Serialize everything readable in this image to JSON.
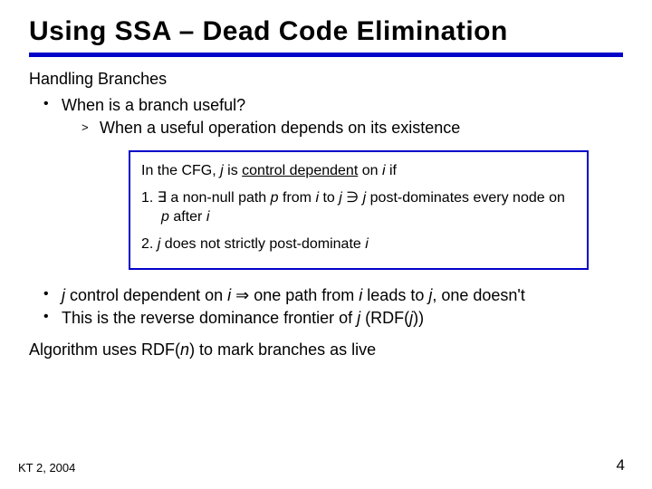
{
  "title": "Using SSA – Dead Code Elimination",
  "subhead": "Handling Branches",
  "bullet1": {
    "main": "When is a branch useful?",
    "sub": "When a useful operation depends on its existence"
  },
  "box": {
    "intro_a": "In the CFG, ",
    "j1": "j",
    "intro_b": " is ",
    "cd": "control dependent",
    "intro_c": " on ",
    "i1": "i",
    "intro_d": "  if",
    "l1_a": "1. ∃ a non-null path ",
    "p": "p",
    "l1_b": " from ",
    "i2": "i",
    "l1_c": " to ",
    "j2": "j",
    "l1_d": " ∋ ",
    "j3": "j",
    "l1_e": " post-dominates every node on ",
    "p2": "p",
    "l1_f": " after ",
    "i3": "i",
    "l2_a": "2. ",
    "j4": "j",
    "l2_b": " does not strictly post-dominate ",
    "i4": "i"
  },
  "bullet2_a": "j",
  "bullet2_b": " control dependent on ",
  "bullet2_c": "i",
  "bullet2_d": " ⇒ one path from ",
  "bullet2_e": "i",
  "bullet2_f": " leads to ",
  "bullet2_g": "j",
  "bullet2_h": ", one doesn't",
  "bullet3_a": "This is the reverse dominance frontier of ",
  "bullet3_b": "j",
  "bullet3_c": "  (RDF(",
  "bullet3_d": "j",
  "bullet3_e": "))",
  "algo_a": "Algorithm uses RDF(",
  "algo_n": "n",
  "algo_b": ") to mark branches as live",
  "footer_left": "KT 2, 2004",
  "footer_right": "4"
}
